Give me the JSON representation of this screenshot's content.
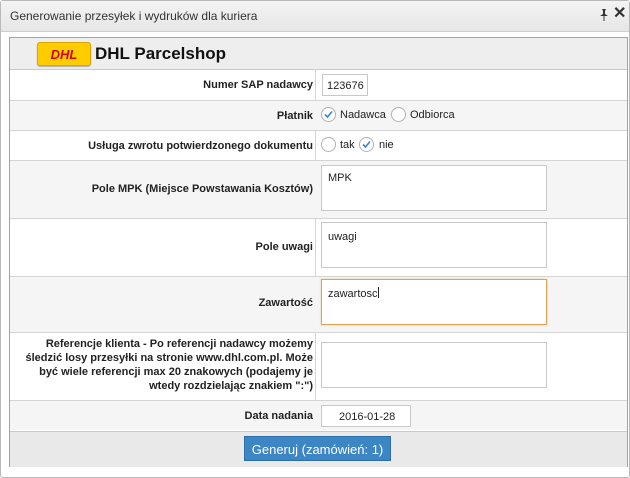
{
  "window": {
    "title": "Generowanie przesyłek i wydruków dla kuriera"
  },
  "header": {
    "logo_text": "DHL",
    "title": "DHL Parcelshop"
  },
  "form": {
    "sap_label": "Numer SAP nadawcy",
    "sap_value": "123676",
    "payer_label": "Płatnik",
    "payer_options": [
      "Nadawca",
      "Odbiorca"
    ],
    "payer_selected": "Nadawca",
    "return_label": "Usługa zwrotu potwierdzonego dokumentu",
    "return_options": [
      "tak",
      "nie"
    ],
    "return_selected": "nie",
    "mpk_label": "Pole MPK (Miejsce Powstawania Kosztów)",
    "mpk_value": "MPK",
    "notes_label": "Pole uwagi",
    "notes_value": "uwagi",
    "content_label": "Zawartość",
    "content_value": "zawartosc",
    "ref_label_lines": [
      "Referencje klienta - Po referencji nadawcy możemy",
      "śledzić losy przesyłki na stronie www.dhl.com.pl. Może",
      "być wiele referencji max 20 znakowych (podajemy je",
      "wtedy rozdzielając znakiem \":\")"
    ],
    "ref_value": "",
    "date_label": "Data nadania",
    "date_value": "2016-01-28"
  },
  "footer": {
    "generate_label": "Generuj (zamówień: 1)"
  },
  "colors": {
    "accent_button": "#3d86c6",
    "dhl_yellow": "#ffcc00",
    "dhl_red": "#d40511",
    "focus_border": "#e0a158"
  }
}
